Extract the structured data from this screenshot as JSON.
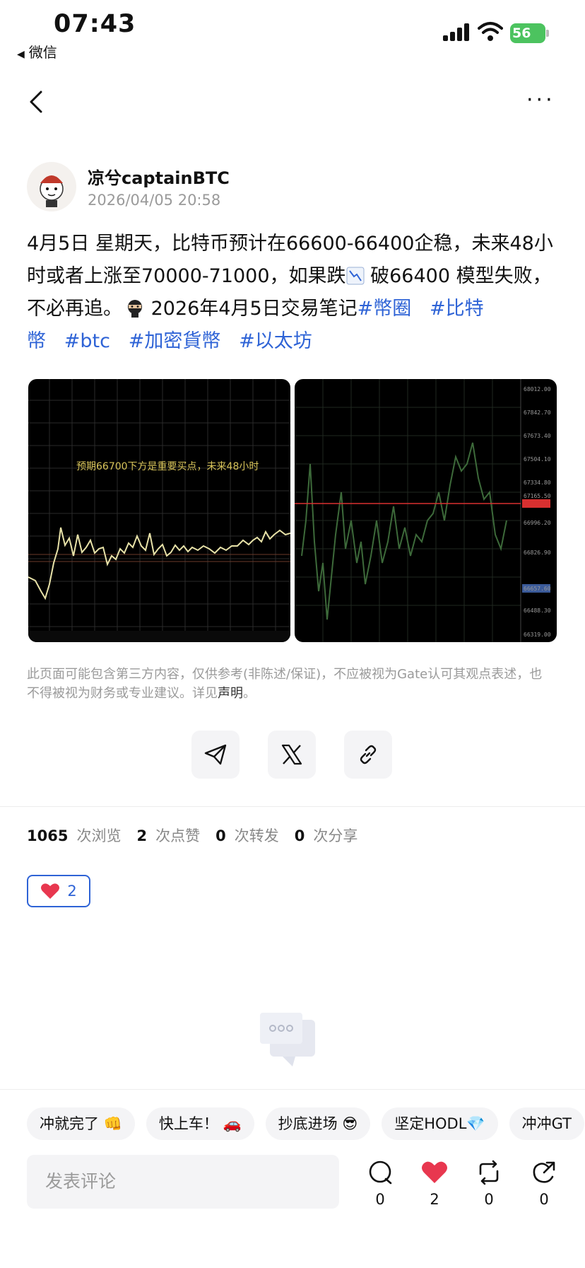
{
  "status_bar": {
    "time": "07:43",
    "back_app": "微信",
    "battery": "56"
  },
  "author": {
    "name": "凉兮captainBTC",
    "date": "2026/04/05 20:58"
  },
  "post": {
    "text_1": "4月5日 星期天，比特币预计在66600-66400企稳，未来48小时或者上涨至70000-71000，如果跌",
    "text_2": " 破66400 模型失败，不必再追。",
    "text_3": " 2026年4月5日交易笔记",
    "tags": [
      "#幣圈",
      "#比特幣",
      "#btc",
      "#加密貨幣",
      "#以太坊"
    ]
  },
  "images": {
    "chart1_caption": "预期66700下方是重要买点，未来48小时",
    "chart2_prices": [
      "68012.00",
      "67842.70",
      "67673.40",
      "67504.10",
      "67334.80",
      "67165.50",
      "66996.20",
      "66826.90",
      "66657.60",
      "66488.30",
      "66319.00"
    ]
  },
  "disclaimer": {
    "text": "此页面可能包含第三方内容，仅供参考(非陈述/保证)，不应被视为Gate认可其观点表述，也不得被视为财务或专业建议。详见",
    "link": "声明",
    "tail": "。"
  },
  "stats": {
    "views": "1065",
    "views_label": "次浏览",
    "likes": "2",
    "likes_label": "次点赞",
    "reposts": "0",
    "reposts_label": "次转发",
    "shares": "0",
    "shares_label": "次分享"
  },
  "reaction": {
    "count": "2"
  },
  "quick_replies": [
    "冲就完了 👊",
    "快上车！ 🚗",
    "抄底进场 😎",
    "坚定HODL💎",
    "冲冲GT"
  ],
  "comment": {
    "placeholder": "发表评论"
  },
  "actions": {
    "comment": "0",
    "like": "2",
    "repost": "0",
    "share": "0"
  },
  "colors": {
    "accent": "#2e63d6",
    "like_red": "#e8374f",
    "battery_green": "#4cc35f"
  }
}
